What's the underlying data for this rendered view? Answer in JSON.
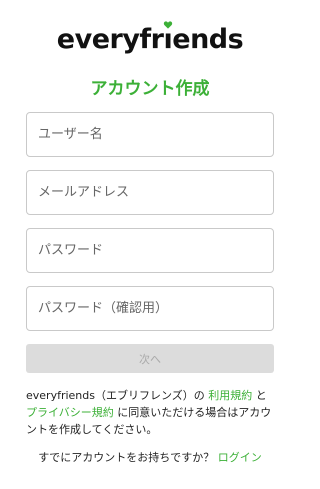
{
  "logo": {
    "text_before": "everyfr",
    "text_i": "ı",
    "text_after": "ends",
    "heart_color": "#3cb037"
  },
  "page": {
    "title": "アカウント作成"
  },
  "form": {
    "email_placeholder": "ユーザー名",
    "mail_placeholder": "メールアドレス",
    "password_placeholder": "パスワード",
    "password_confirm_placeholder": "パスワード（確認用）",
    "next_label": "次へ"
  },
  "terms": {
    "prefix": "everyfriends（エブリフレンズ）の ",
    "terms_link": "利用規約",
    "and": " と ",
    "privacy_link": "プライバシー規約",
    "suffix": " に同意いただける場合はアカウントを作成してください。"
  },
  "login": {
    "question": "すでにアカウントをお持ちですか？ ",
    "link": "ログイン"
  },
  "colors": {
    "accent": "#3cb037",
    "button_disabled": "#dcdcdc"
  }
}
